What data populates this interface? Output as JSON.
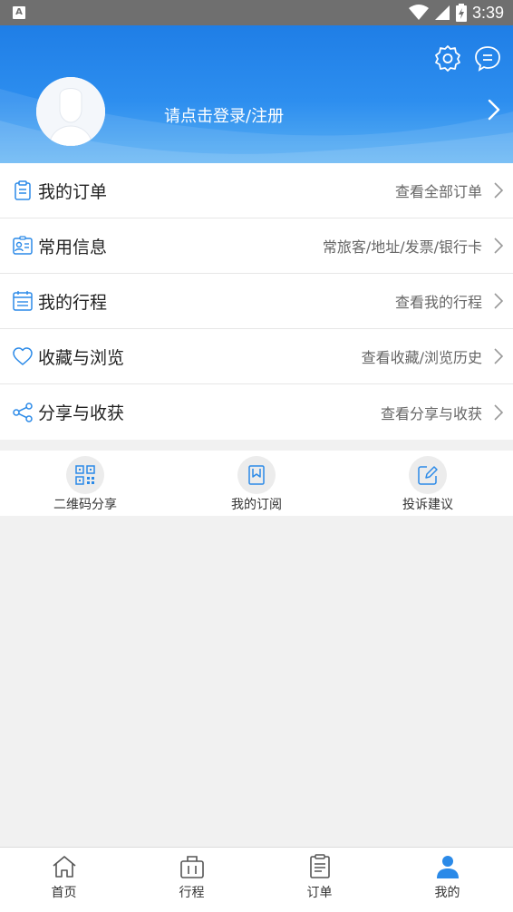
{
  "status_bar": {
    "time": "3:39"
  },
  "header": {
    "login_text": "请点击登录/注册"
  },
  "menu": [
    {
      "icon": "clipboard-icon",
      "label": "我的订单",
      "hint": "查看全部订单"
    },
    {
      "icon": "contact-card-icon",
      "label": "常用信息",
      "hint": "常旅客/地址/发票/银行卡"
    },
    {
      "icon": "calendar-list-icon",
      "label": "我的行程",
      "hint": "查看我的行程"
    },
    {
      "icon": "heart-icon",
      "label": "收藏与浏览",
      "hint": "查看收藏/浏览历史"
    },
    {
      "icon": "share-icon",
      "label": "分享与收获",
      "hint": "查看分享与收获"
    }
  ],
  "tools": [
    {
      "icon": "qr-code-icon",
      "label": "二维码分享"
    },
    {
      "icon": "bookmark-icon",
      "label": "我的订阅"
    },
    {
      "icon": "edit-icon",
      "label": "投诉建议"
    }
  ],
  "bottom_nav": [
    {
      "icon": "home-icon",
      "label": "首页"
    },
    {
      "icon": "luggage-icon",
      "label": "行程"
    },
    {
      "icon": "order-icon",
      "label": "订单"
    },
    {
      "icon": "person-icon",
      "label": "我的",
      "active": true
    }
  ],
  "colors": {
    "accent": "#2b8ae8",
    "header_top": "#1f7ee6",
    "header_bottom": "#5ab0f3"
  }
}
